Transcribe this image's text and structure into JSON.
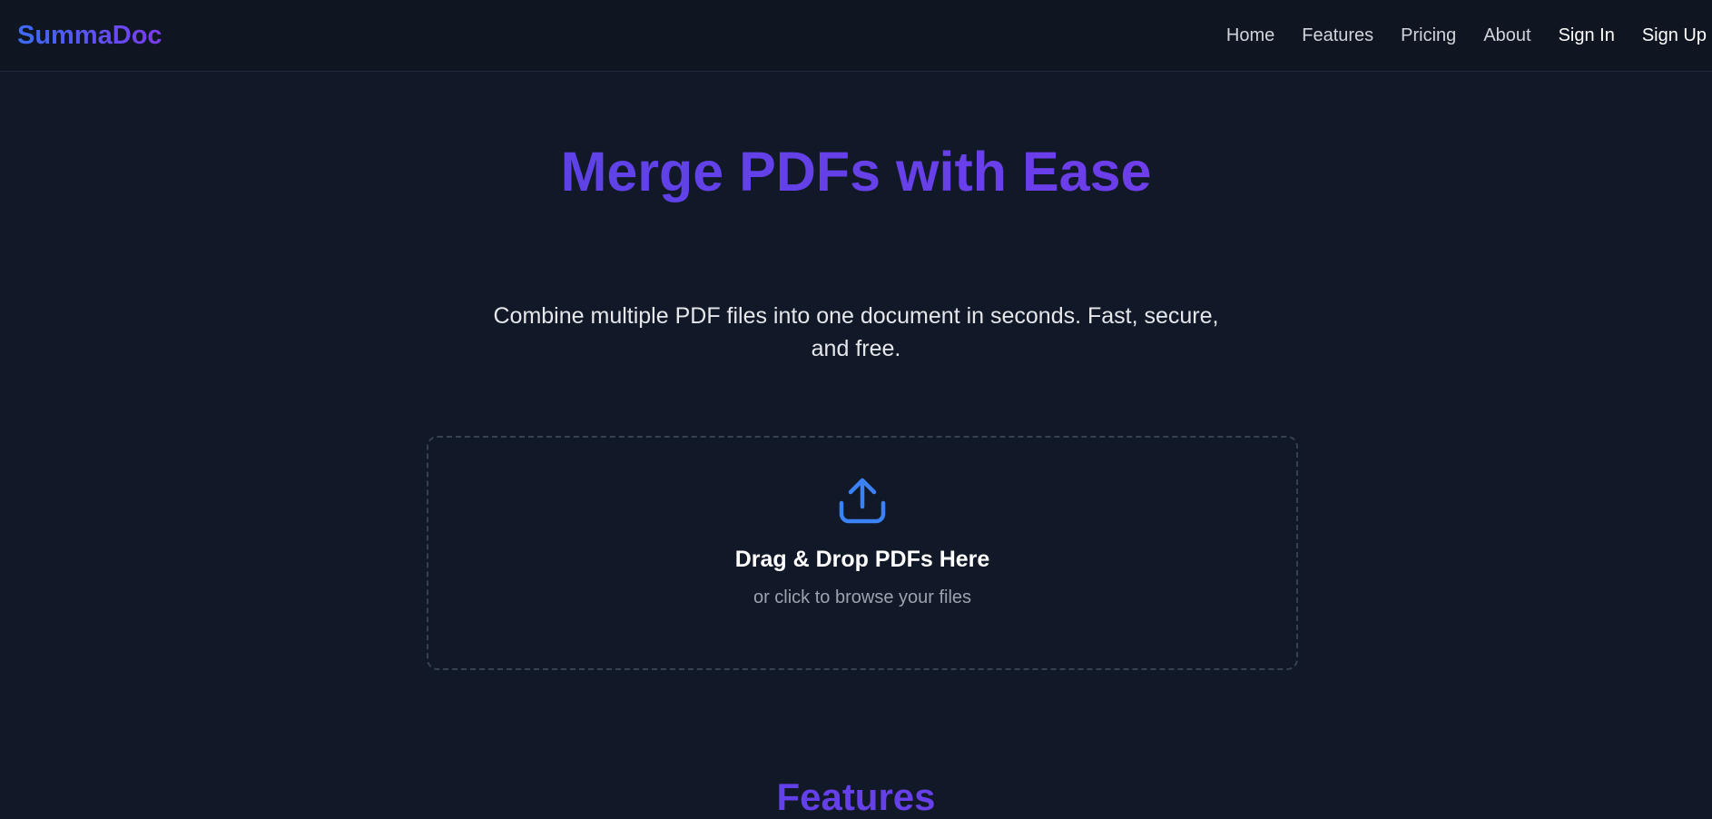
{
  "nav": {
    "brand": "SummaDoc",
    "links": [
      "Home",
      "Features",
      "Pricing",
      "About"
    ],
    "sign_in": "Sign In",
    "sign_up": "Sign Up"
  },
  "hero": {
    "title": "Merge PDFs with Ease",
    "subtitle": "Combine multiple PDF files into one document in seconds. Fast, secure, and free."
  },
  "dropzone": {
    "icon": "upload-icon",
    "title": "Drag & Drop PDFs Here",
    "subtitle": "or click to browse your files"
  },
  "features": {
    "heading": "Features"
  },
  "colors": {
    "background": "#111827",
    "navbar": "#0f1521",
    "accent_blue": "#3b82f6",
    "accent_purple": "#7c3aed"
  }
}
